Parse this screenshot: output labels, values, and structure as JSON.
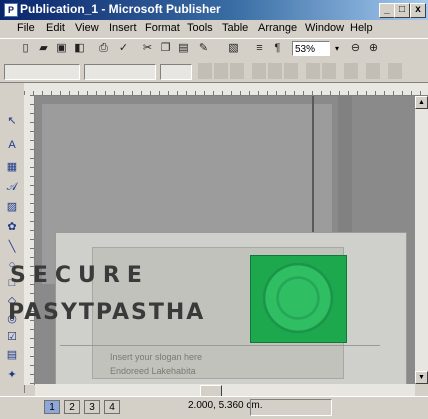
{
  "window": {
    "title": "Publication_1 - Microsoft Publisher",
    "app_icon": "publisher-icon",
    "buttons": [
      {
        "name": "minimize-button",
        "glyph": "_"
      },
      {
        "name": "maximize-button",
        "glyph": "□"
      },
      {
        "name": "close-button",
        "glyph": "x"
      }
    ]
  },
  "menu": {
    "items": [
      "File",
      "Edit",
      "View",
      "Insert",
      "Format",
      "Tools",
      "Table",
      "Arrange",
      "Window",
      "Help"
    ]
  },
  "toolbar": {
    "zoom_value": "53%",
    "zoom_arrow": "▾",
    "zoom_out": "⊖",
    "zoom_in": "⊕"
  },
  "objects_toolbar": {
    "icons": [
      "pointer-icon",
      "text-frame-icon",
      "table-icon",
      "wordart-icon",
      "picture-icon",
      "clip-art-icon",
      "line-icon",
      "oval-icon",
      "rectangle-icon",
      "custom-shape-icon",
      "hot-spot-icon",
      "form-control-icon",
      "html-fragment-icon",
      "design-gallery-icon"
    ]
  },
  "card": {
    "line1": "SECURE",
    "line2_a": "PASYTPAS",
    "line2_b": "THA",
    "small_line1": "Insert your slogan here",
    "small_line2": "Endoreed Lakehabita"
  },
  "status": {
    "page_tabs": [
      "1",
      "2",
      "3",
      "4"
    ],
    "position": "2.000, 5.360 cm."
  },
  "colors": {
    "title_bar": "#0a246a",
    "logo_green": "#1ea84e"
  }
}
